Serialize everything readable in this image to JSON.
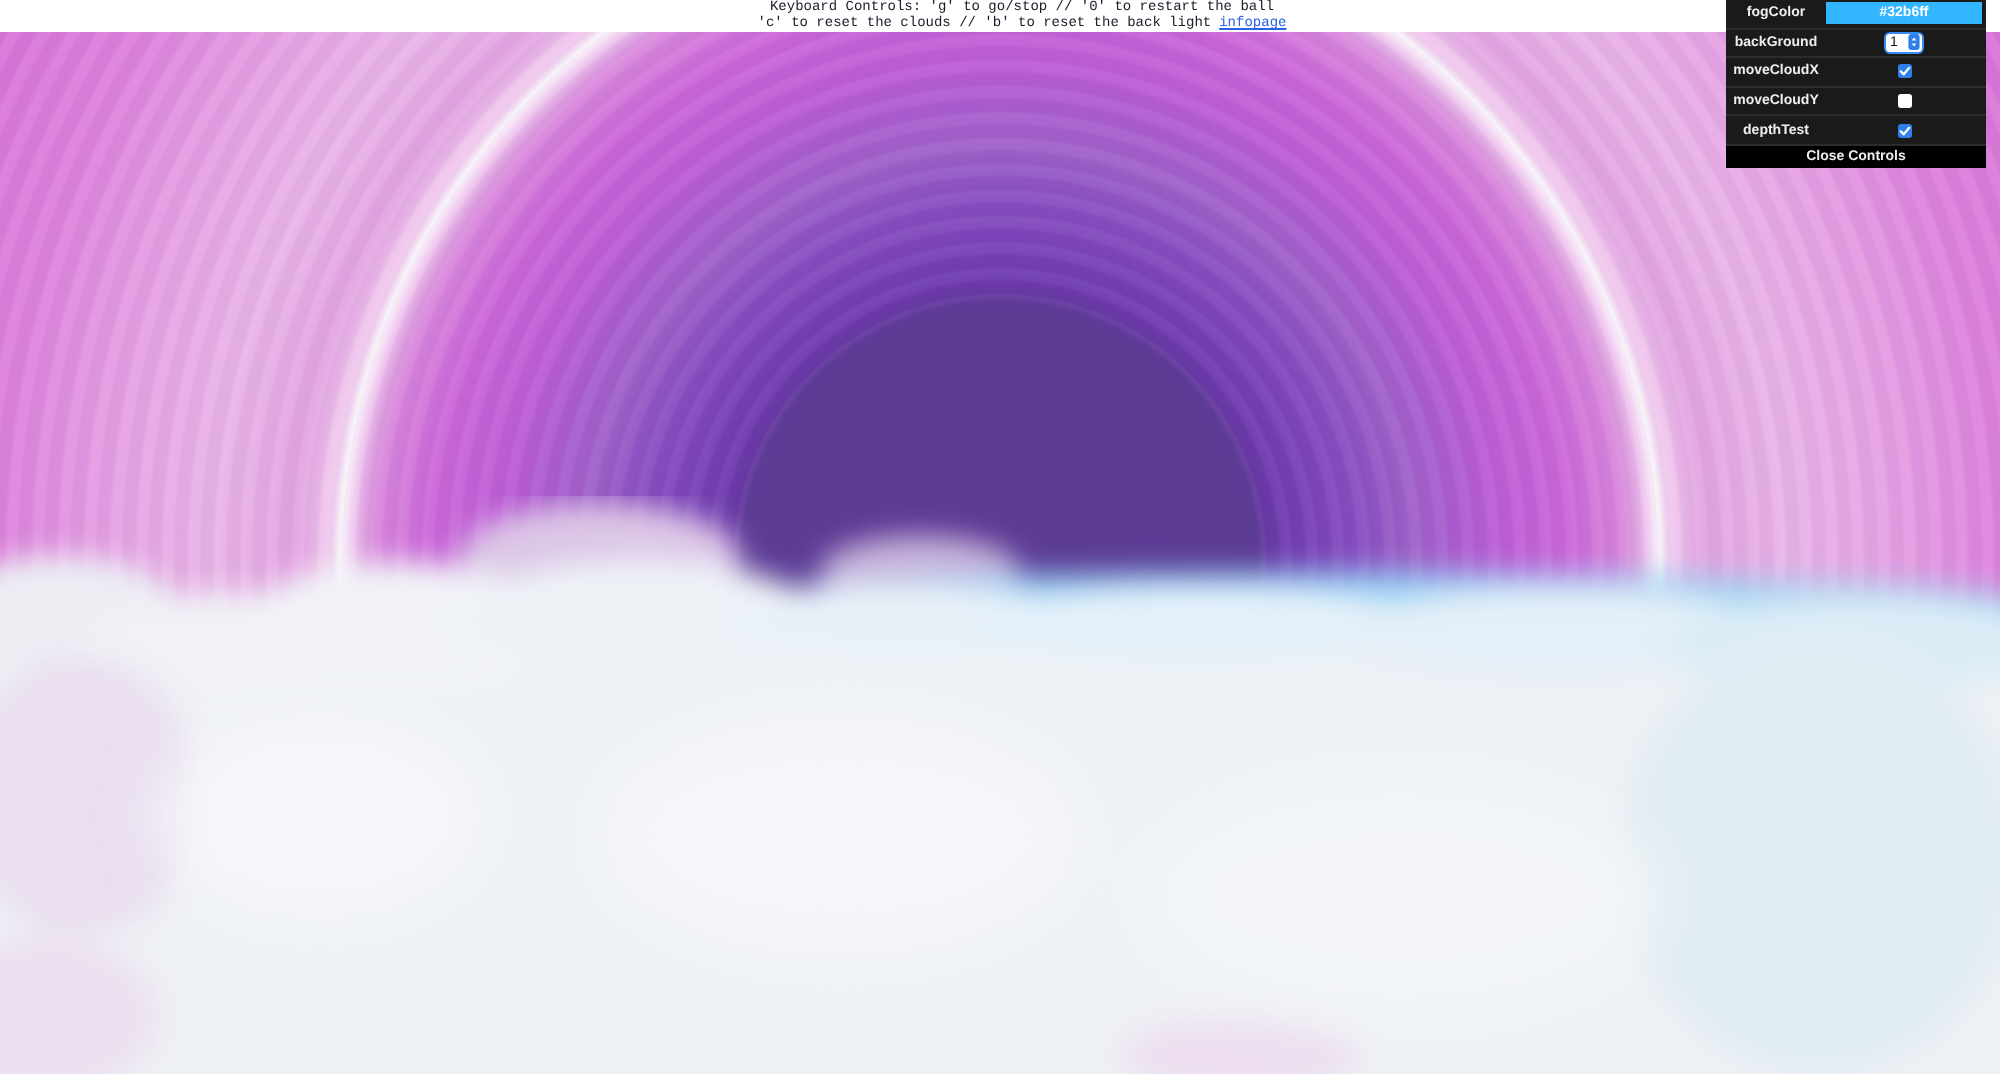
{
  "header": {
    "lines": [
      {
        "text": "Keyboard Controls: 'g' to go/stop // '0' to restart the ball"
      },
      {
        "text": "'c' to reset the clouds // 'b' to reset the back light",
        "link": "infopage"
      }
    ]
  },
  "controls": {
    "rows": [
      {
        "kind": "color",
        "label": "fogColor",
        "value": "#32b6ff",
        "color": "#32b6ff"
      },
      {
        "kind": "number",
        "label": "backGround",
        "value": "1"
      },
      {
        "kind": "checkbox",
        "label": "moveCloudX",
        "checked": true
      },
      {
        "kind": "checkbox",
        "label": "moveCloudY",
        "checked": false
      },
      {
        "kind": "checkbox",
        "label": "depthTest",
        "checked": true
      }
    ],
    "close_button": "Close Controls"
  }
}
